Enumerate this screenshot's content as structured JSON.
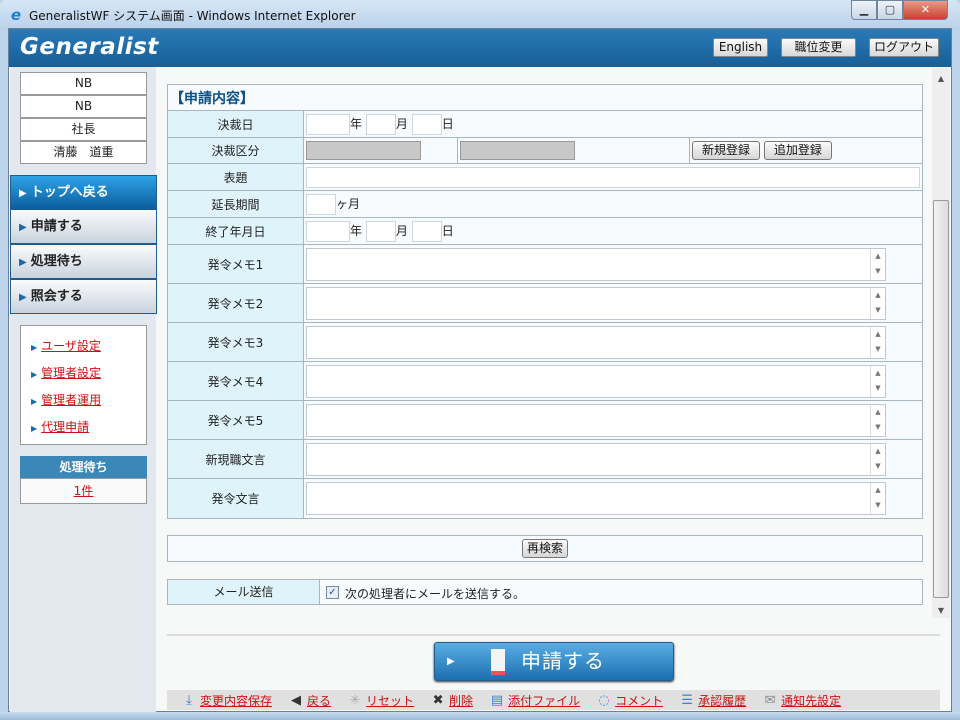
{
  "window": {
    "title": "GeneralistWF システム画面 - Windows Internet Explorer",
    "minimize": "▁",
    "maximize": "▢",
    "close": "✕"
  },
  "header": {
    "logo": "Generalist",
    "english": "English",
    "change_role": "職位変更",
    "logout": "ログアウト"
  },
  "user": [
    "NB",
    "NB",
    "社長",
    "清藤　道重"
  ],
  "nav": [
    {
      "label": "トップへ戻る",
      "active": true
    },
    {
      "label": "申請する"
    },
    {
      "label": "処理待ち"
    },
    {
      "label": "照会する"
    }
  ],
  "links": [
    "ユーザ設定",
    "管理者設定",
    "管理者運用",
    "代理申請"
  ],
  "pending": {
    "title": "処理待ち",
    "count": "1件"
  },
  "form": {
    "title": "【申請内容】",
    "decision_date": {
      "label": "決裁日",
      "year": "年",
      "month": "月",
      "day": "日"
    },
    "decision_type": {
      "label": "決裁区分",
      "new": "新規登録",
      "add": "追加登録"
    },
    "subject": {
      "label": "表題"
    },
    "extension": {
      "label": "延長期間",
      "unit": "ヶ月"
    },
    "end_date": {
      "label": "終了年月日",
      "year": "年",
      "month": "月",
      "day": "日"
    },
    "memos": [
      "発令メモ1",
      "発令メモ2",
      "発令メモ3",
      "発令メモ4",
      "発令メモ5",
      "新現職文言",
      "発令文言"
    ]
  },
  "research": "再検索",
  "mail": {
    "label": "メール送信",
    "checked": true,
    "text": "次の処理者にメールを送信する。"
  },
  "submit": "申請する",
  "toolbar": [
    {
      "icon": "download-icon",
      "glyph": "⤓",
      "label": "変更内容保存",
      "color": "#3a7fd0"
    },
    {
      "icon": "back-arrow-icon",
      "glyph": "◀",
      "label": "戻る",
      "color": "#333"
    },
    {
      "icon": "reset-icon",
      "glyph": "✳",
      "label": "リセット",
      "color": "#aaa"
    },
    {
      "icon": "delete-icon",
      "glyph": "✖",
      "label": "削除",
      "color": "#333"
    },
    {
      "icon": "attach-file-icon",
      "glyph": "▤",
      "label": "添付ファイル",
      "color": "#3a7fd0"
    },
    {
      "icon": "comment-icon",
      "glyph": "◌",
      "label": "コメント",
      "color": "#3a8fe0"
    },
    {
      "icon": "history-list-icon",
      "glyph": "☰",
      "label": "承認履歴",
      "color": "#3a7fd0"
    },
    {
      "icon": "mail-icon",
      "glyph": "✉",
      "label": "通知先設定",
      "color": "#888"
    }
  ]
}
